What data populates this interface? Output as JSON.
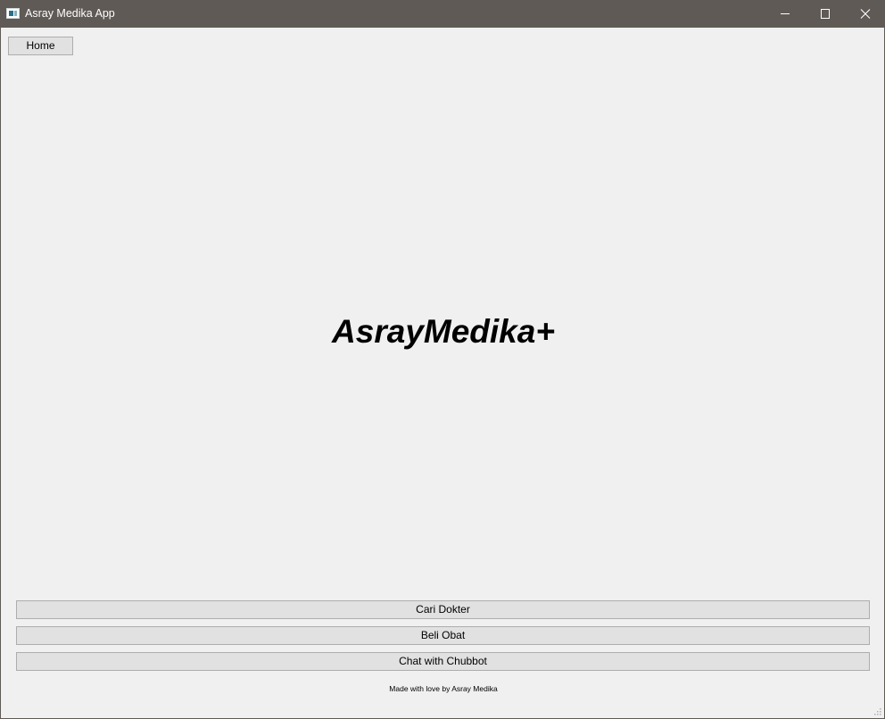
{
  "window": {
    "title": "Asray Medika App",
    "controls": [
      "minimize-icon",
      "maximize-icon",
      "close-icon"
    ],
    "titlebar_color": "#5f5a55"
  },
  "toolbar": {
    "home_label": "Home"
  },
  "main": {
    "brand_title": "AsrayMedika+"
  },
  "menu": {
    "cari_dokter_label": "Cari Dokter",
    "beli_obat_label": "Beli Obat",
    "chat_label": "Chat with Chubbot"
  },
  "footer": {
    "text": "Made with love by Asray Medika"
  }
}
